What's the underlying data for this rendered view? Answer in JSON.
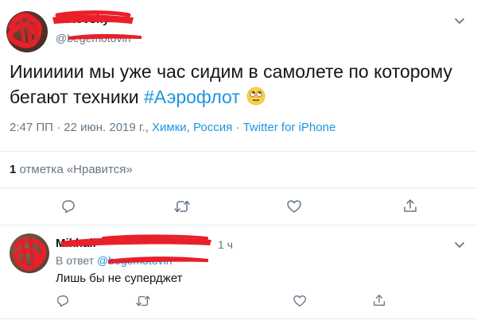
{
  "tweet": {
    "author_name": "Kotovsky",
    "author_handle": "@begemotovin",
    "text_line1": "Иииииии мы уже час сидим в самолете по которому",
    "text_line2_pre": "бегают техники",
    "hashtag": "#Аэрофлот",
    "emoji": "face-with-rolling-eyes",
    "time": "2:47 ПП · 22 июн. 2019 г.,",
    "location": "Химки, Россия",
    "sep": "·",
    "source": "Twitter for iPhone",
    "likes_count": "1",
    "likes_label": "отметка «Нравится»"
  },
  "reply": {
    "author_name": "Mikhail",
    "time_ago": "1 ч",
    "in_reply_prefix": "В ответ",
    "in_reply_handle": "@begemotovin",
    "text": "Лишь бы не суперджет"
  },
  "colors": {
    "link": "#1b95e0",
    "muted": "#657786",
    "redaction": "#e8202a"
  }
}
